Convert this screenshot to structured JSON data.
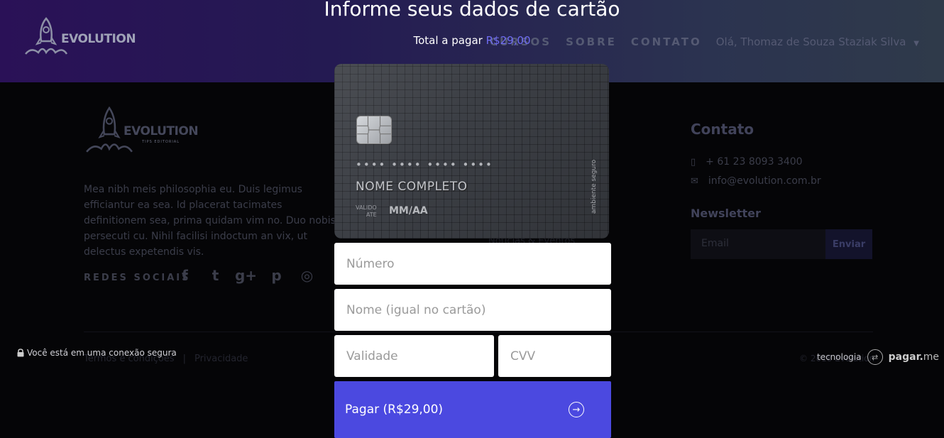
{
  "site": {
    "logo_text": "EVOLUTION",
    "logo_sub": "TIPS EDITORIAL",
    "nav": [
      "CURSOS",
      "SOBRE",
      "CONTATO"
    ],
    "user_menu": "Olá, Thomaz de Souza Staziak Silva",
    "about_text": "Mea nibh meis philosophia eu. Duis legimus efficiantur ea sea. Id placerat tacimates definitionem sea, prima quidam vim no. Duo nobis persecuti cu. Nihil facilisi indoctum an vix, ut delectus expetendis vis.",
    "social_label": "REDES SOCIAIS",
    "social_icons": [
      "facebook-icon",
      "twitter-icon",
      "googleplus-icon",
      "pinterest-icon",
      "instagram-icon"
    ],
    "contact_title": "Contato",
    "phone": "+ 61 23 8093 3400",
    "email": "info@evolution.com.br",
    "newsletter_title": "Newsletter",
    "newsletter_placeholder": "Email",
    "newsletter_button": "Enviar",
    "link_terms": "Termos e condições",
    "link_separator": "|",
    "link_privacy": "Privacidade",
    "copyright": "© 2018 Evolution",
    "watermark": "Noticias & Eventos"
  },
  "checkout": {
    "title": "Informe seus dados de cartão",
    "total_label": "Total a pagar",
    "total_amount": "R$29,00",
    "card": {
      "number_mask": "•••• •••• •••• ••••",
      "name_placeholder": "NOME COMPLETO",
      "valid_label_1": "VALIDO",
      "valid_label_2": "ATE",
      "expiry_placeholder": "MM/AA",
      "secure_label": "ambiente seguro"
    },
    "fields": {
      "number_placeholder": "Número",
      "name_placeholder": "Nome (igual no cartão)",
      "expiry_placeholder": "Validade",
      "cvv_placeholder": "CVV"
    },
    "pay_button": "Pagar (R$29,00)",
    "secure_note": "Você está em uma conexão segura",
    "tech_label": "tecnologia",
    "brand_bold": "pagar.",
    "brand_rest": "me"
  },
  "colors": {
    "accent": "#4b49e0",
    "amount": "#6f6cf2"
  }
}
